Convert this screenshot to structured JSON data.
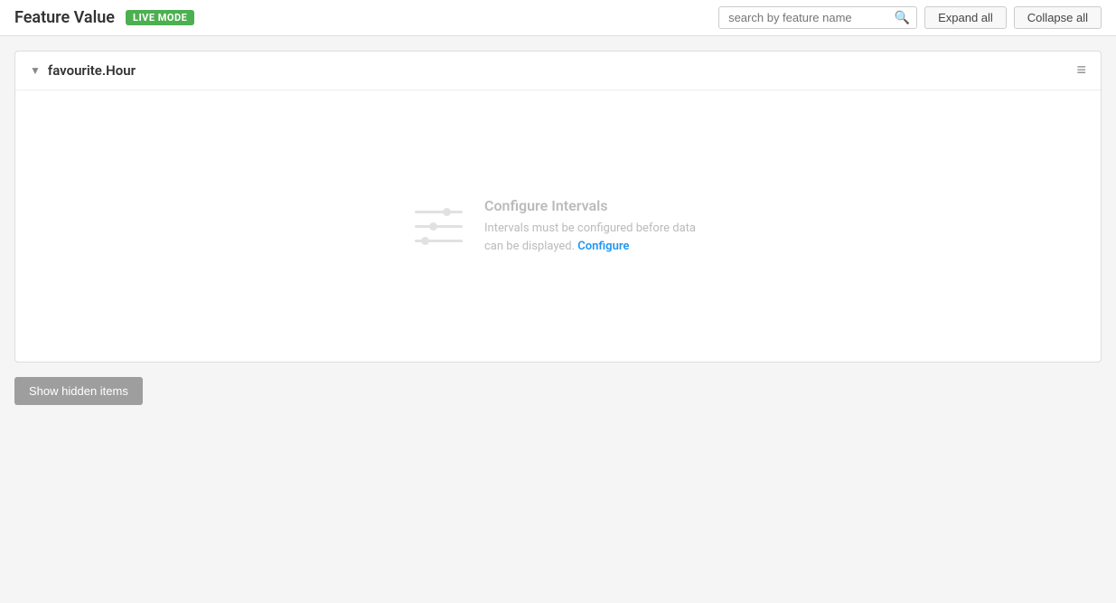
{
  "header": {
    "title": "Feature Value",
    "live_mode_label": "LIVE MODE",
    "search_placeholder": "search by feature name",
    "expand_all_label": "Expand all",
    "collapse_all_label": "Collapse all"
  },
  "feature_card": {
    "name": "favourite.Hour",
    "configure_title": "Configure Intervals",
    "configure_description": "Intervals must be configured before data can be displayed.",
    "configure_link_label": "Configure"
  },
  "footer": {
    "show_hidden_label": "Show hidden items"
  }
}
